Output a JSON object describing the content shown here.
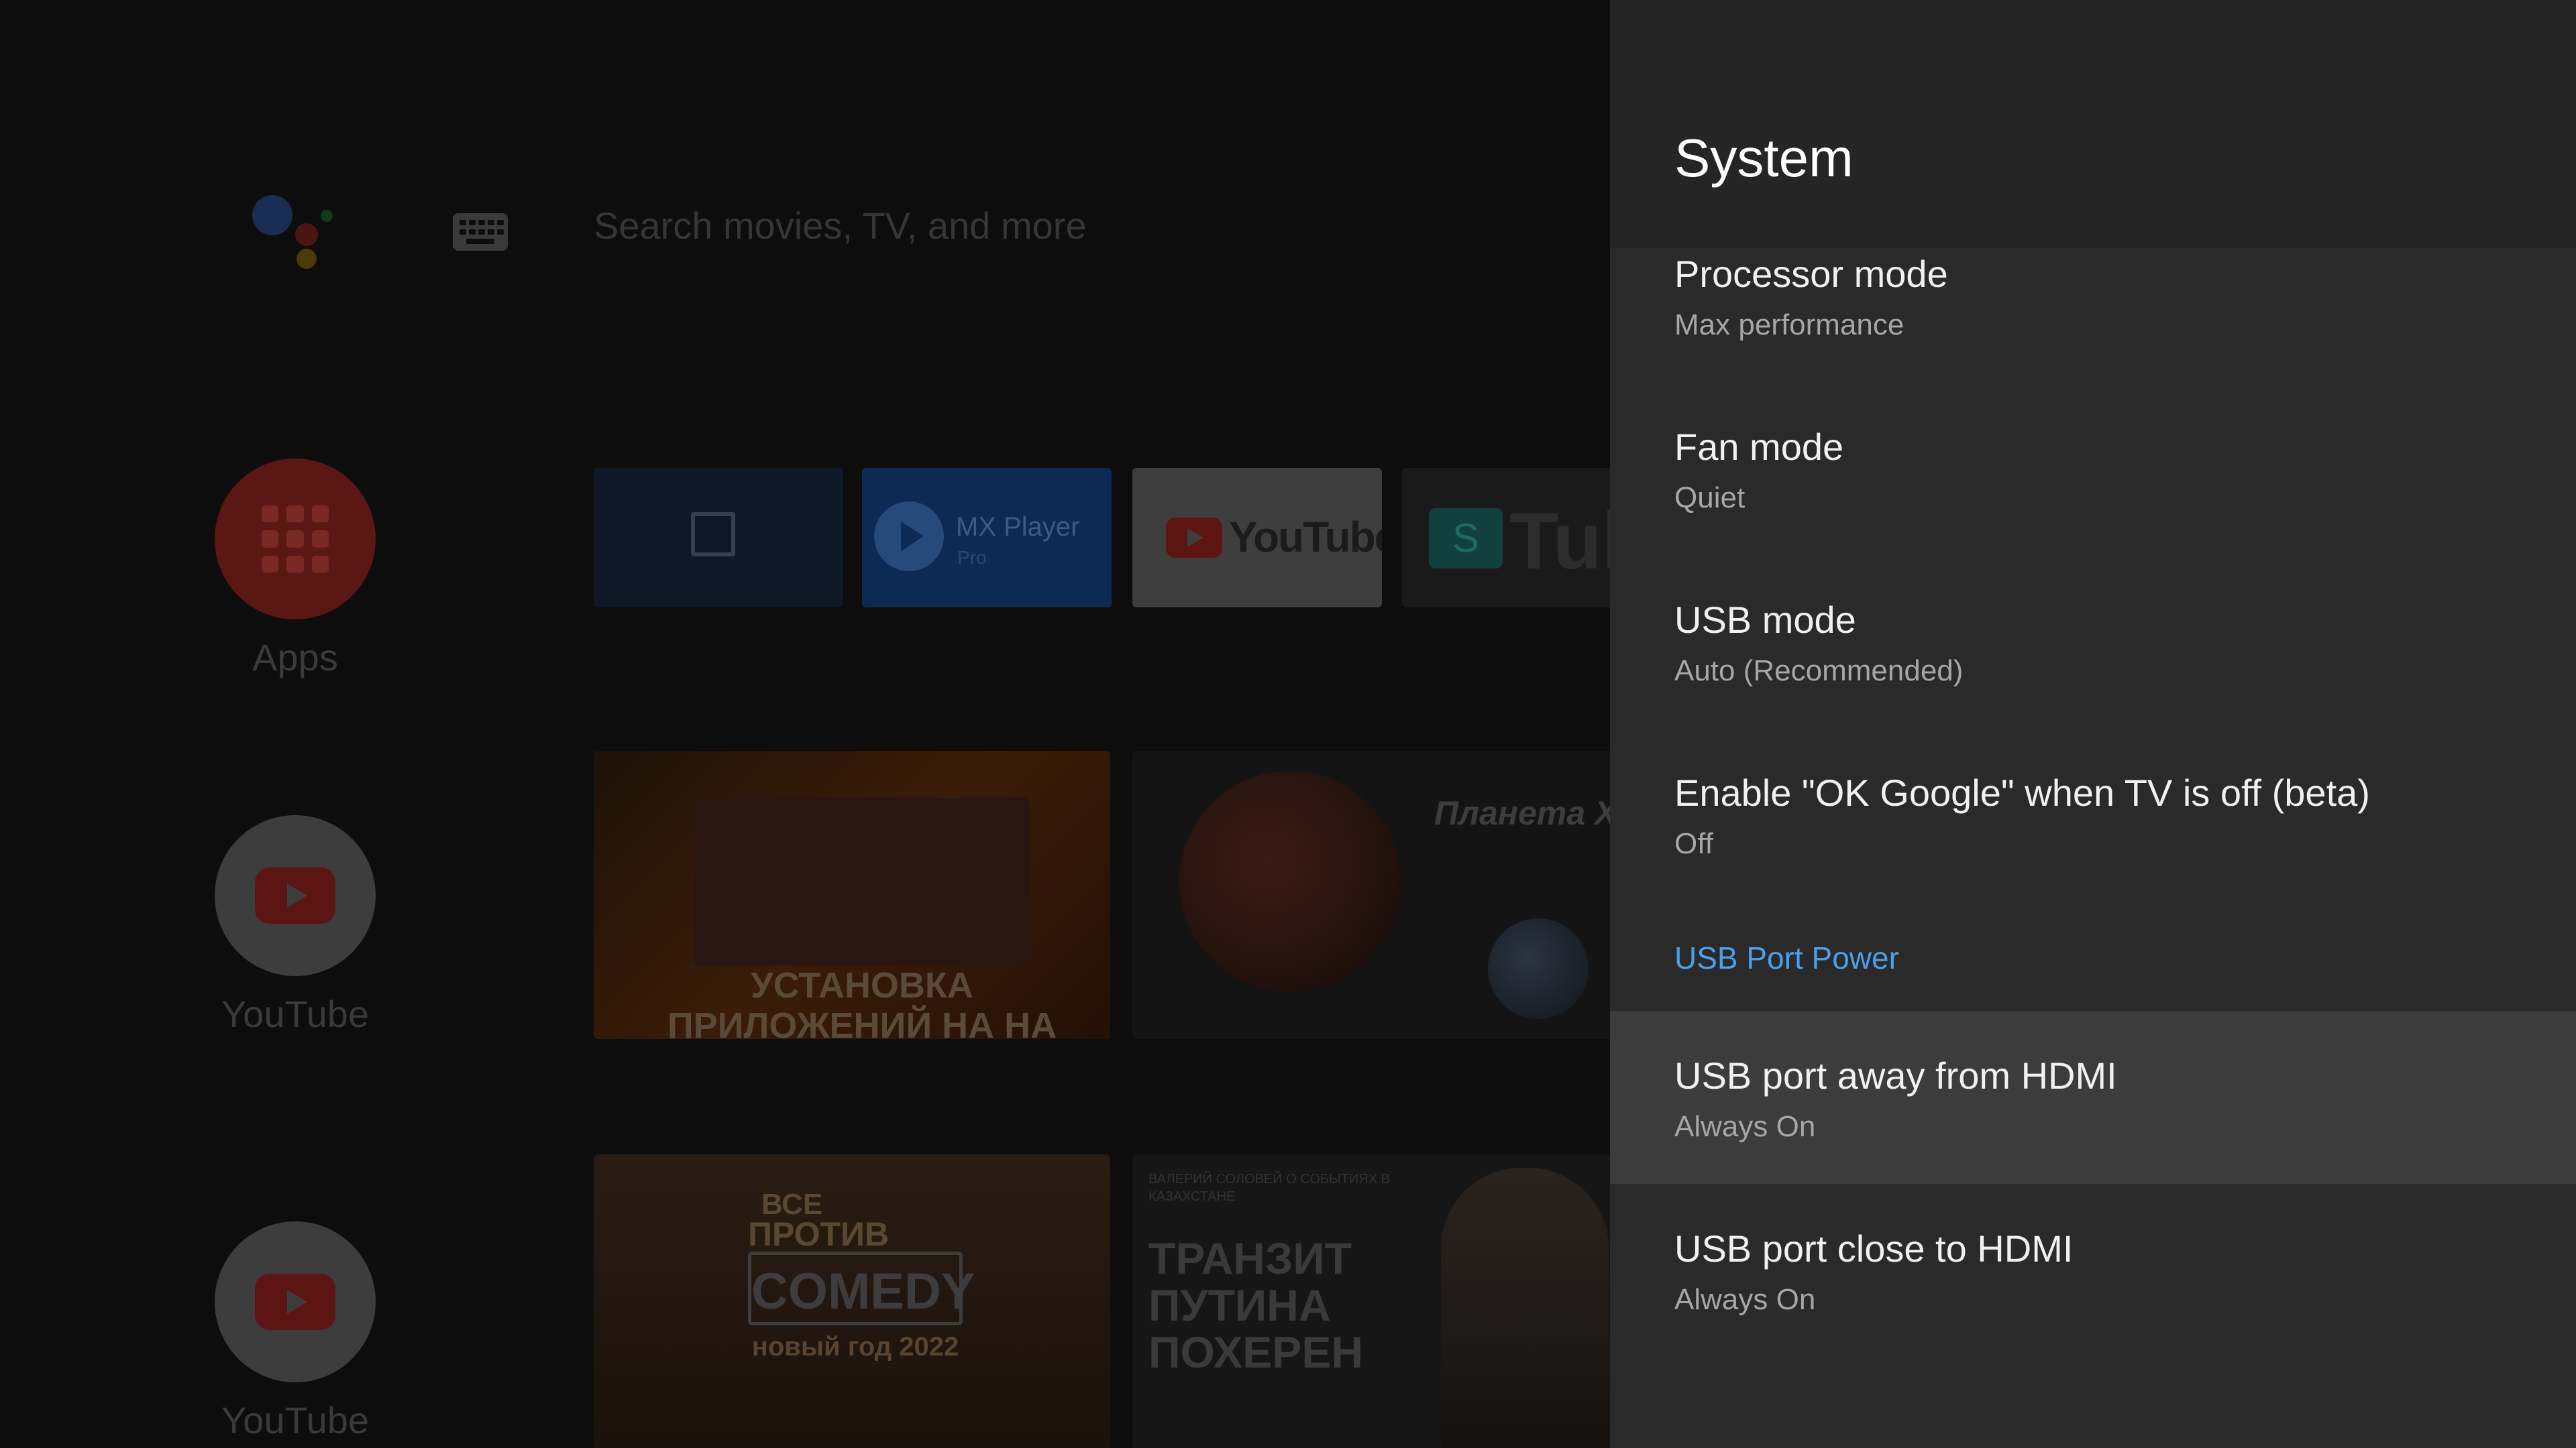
{
  "home": {
    "search_placeholder": "Search movies, TV, and more",
    "apps_label": "Apps",
    "favorites": [
      {
        "label": "YouTube"
      },
      {
        "label": "YouTube"
      }
    ],
    "channel_tiles": {
      "mx_player": {
        "name": "MX Player",
        "badge": "Pro"
      },
      "youtube": {
        "name": "YouTube"
      },
      "smart_tube": {
        "letter": "S",
        "name": "Tube"
      }
    },
    "cards": {
      "install_apps": {
        "title": "УСТАНОВКА ПРИЛОЖЕНИЙ НА НА АНДРОИД ТВ И ПРИСТАВКИ"
      },
      "planet": {
        "title": "Планета Х"
      },
      "comedy": {
        "line1": "ВСЕ",
        "line2": "ПРОТИВ",
        "logo": "COMEDY",
        "line3": "новый год 2022"
      },
      "transit": {
        "pre": "ВАЛЕРИЙ СОЛОВЕЙ О СОБЫТИЯХ В КАЗАХСТАНЕ",
        "line1": "ТРАНЗИТ",
        "line2": "ПУТИНА",
        "line3": "ПОХЕРЕН"
      }
    }
  },
  "panel": {
    "title": "System",
    "items": [
      {
        "title": "Processor mode",
        "value": "Max performance"
      },
      {
        "title": "Fan mode",
        "value": "Quiet"
      },
      {
        "title": "USB mode",
        "value": "Auto (Recommended)"
      },
      {
        "title": "Enable \"OK Google\" when TV is off (beta)",
        "value": "Off"
      }
    ],
    "section_header": "USB Port Power",
    "usb_items": [
      {
        "title": "USB port away from HDMI",
        "value": "Always On"
      },
      {
        "title": "USB port close to HDMI",
        "value": "Always On"
      }
    ],
    "colors": {
      "accent": "#4aa0ea",
      "panel_bg": "#2a2a2a",
      "focused_bg": "#3c3c3c"
    }
  }
}
